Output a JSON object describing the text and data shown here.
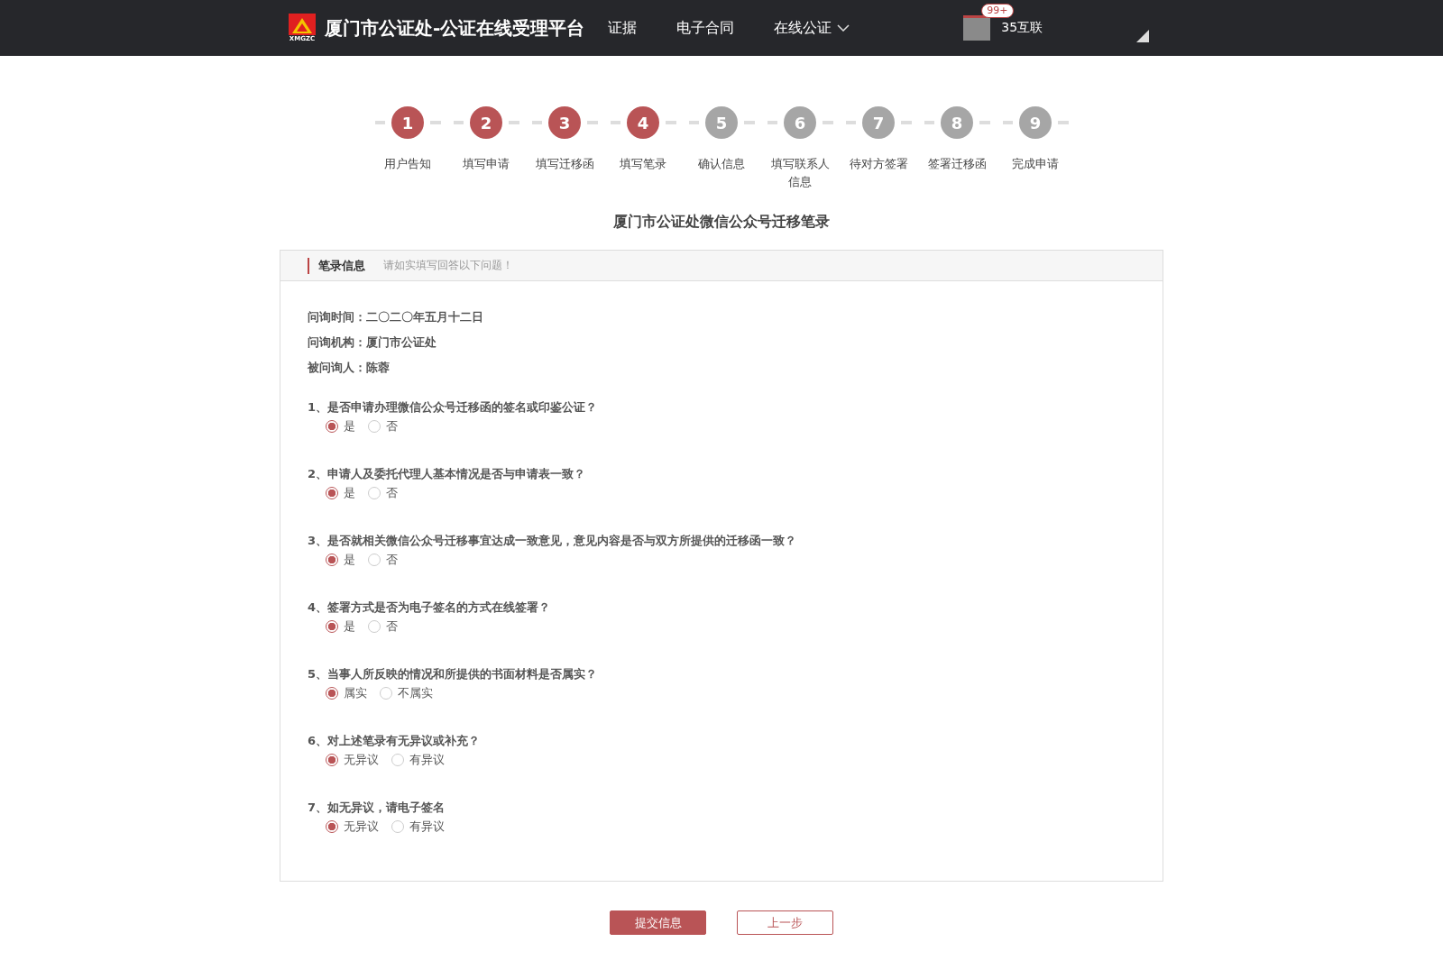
{
  "header": {
    "logo_text": "XMGZC",
    "title": "厦门市公证处-公证在线受理平台",
    "nav": [
      {
        "label": "证据",
        "dropdown": false
      },
      {
        "label": "电子合同",
        "dropdown": false
      },
      {
        "label": "在线公证",
        "dropdown": true
      }
    ],
    "user": {
      "badge": "99+",
      "name": "35互联"
    }
  },
  "steps": [
    {
      "number": "1",
      "label": "用户告知",
      "done": true
    },
    {
      "number": "2",
      "label": "填写申请",
      "done": true
    },
    {
      "number": "3",
      "label": "填写迁移函",
      "done": true
    },
    {
      "number": "4",
      "label": "填写笔录",
      "done": true
    },
    {
      "number": "5",
      "label": "确认信息",
      "done": false
    },
    {
      "number": "6",
      "label": "填写联系人信息",
      "done": false
    },
    {
      "number": "7",
      "label": "待对方签署",
      "done": false
    },
    {
      "number": "8",
      "label": "签署迁移函",
      "done": false
    },
    {
      "number": "9",
      "label": "完成申请",
      "done": false
    }
  ],
  "page_title": "厦门市公证处微信公众号迁移笔录",
  "panel": {
    "title": "笔录信息",
    "hint": "请如实填写回答以下问题！",
    "info": [
      "问询时间：二〇二〇年五月十二日",
      "问询机构：厦门市公证处",
      "被问询人：陈蓉"
    ],
    "questions": [
      {
        "text": "1、是否申请办理微信公众号迁移函的签名或印鉴公证？",
        "options": [
          {
            "label": "是",
            "selected": true
          },
          {
            "label": "否",
            "selected": false
          }
        ]
      },
      {
        "text": "2、申请人及委托代理人基本情况是否与申请表一致？",
        "options": [
          {
            "label": "是",
            "selected": true
          },
          {
            "label": "否",
            "selected": false
          }
        ]
      },
      {
        "text": "3、是否就相关微信公众号迁移事宜达成一致意见，意见内容是否与双方所提供的迁移函一致？",
        "options": [
          {
            "label": "是",
            "selected": true
          },
          {
            "label": "否",
            "selected": false
          }
        ]
      },
      {
        "text": "4、签署方式是否为电子签名的方式在线签署？",
        "options": [
          {
            "label": "是",
            "selected": true
          },
          {
            "label": "否",
            "selected": false
          }
        ]
      },
      {
        "text": "5、当事人所反映的情况和所提供的书面材料是否属实？",
        "options": [
          {
            "label": "属实",
            "selected": true
          },
          {
            "label": "不属实",
            "selected": false
          }
        ]
      },
      {
        "text": "6、对上述笔录有无异议或补充？",
        "options": [
          {
            "label": "无异议",
            "selected": true
          },
          {
            "label": "有异议",
            "selected": false
          }
        ]
      },
      {
        "text": "7、如无异议，请电子签名",
        "options": [
          {
            "label": "无异议",
            "selected": true
          },
          {
            "label": "有异议",
            "selected": false
          }
        ]
      }
    ]
  },
  "buttons": [
    {
      "label": "提交信息",
      "kind": "primary"
    },
    {
      "label": "上一步",
      "kind": "secondary"
    }
  ]
}
